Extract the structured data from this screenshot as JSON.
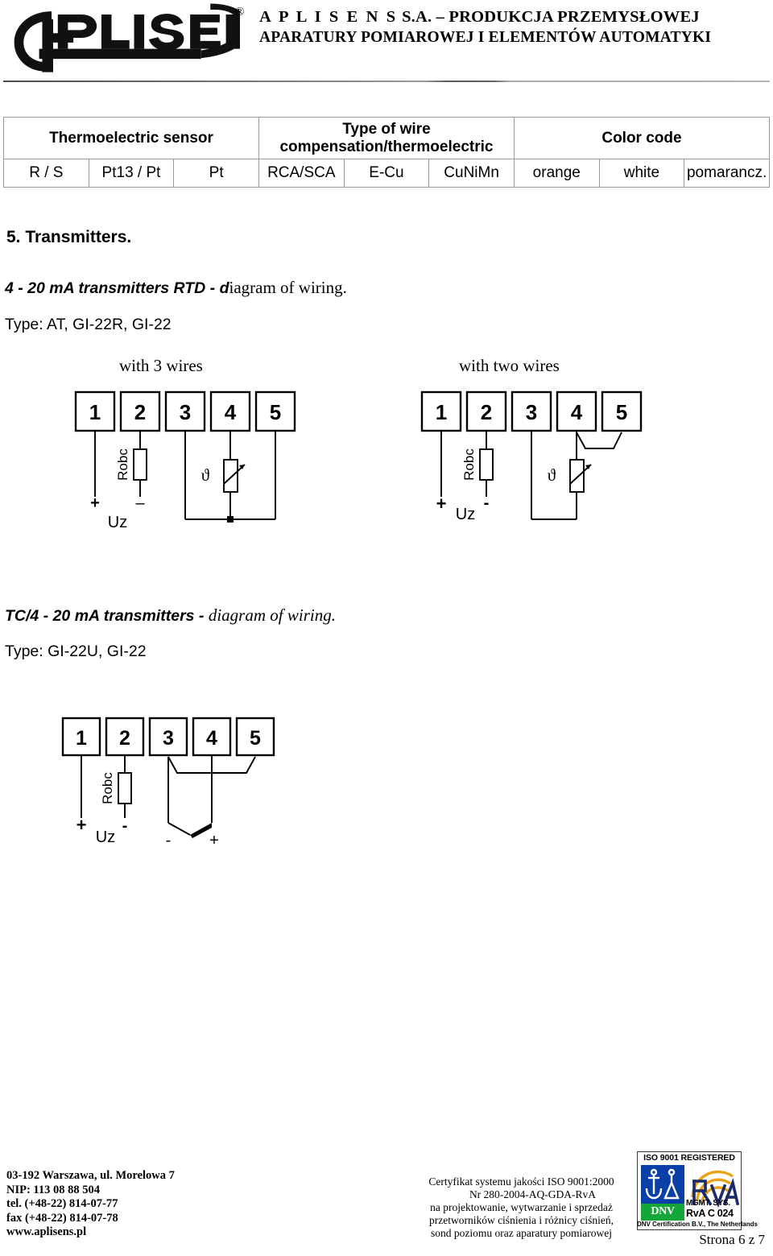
{
  "header": {
    "logo_text": "APLISENS",
    "registered_mark": "®",
    "company_line1_a": "A P L I S E N S",
    "company_line1_b": " S.A. – PRODUKCJA PRZEMYSŁOWEJ",
    "company_line2": "APARATURY POMIAROWEJ I ELEMENTÓW AUTOMATYKI"
  },
  "table": {
    "headers": [
      "Thermoelectric sensor",
      "Type of wire compensation/thermoelectric",
      "Color code"
    ],
    "header_line1_col2": "Type of wire",
    "header_line2_col2": "compensation/thermoelectric",
    "row": [
      "R / S",
      "Pt13 / Pt",
      "Pt",
      "RCA/SCA",
      "E-Cu",
      "CuNiMn",
      "orange",
      "white",
      "pomarancz."
    ]
  },
  "content": {
    "section_title": "5. Transmitters.",
    "rtd_subtitle_sans": "4 - 20 mA transmitters RTD - d",
    "rtd_subtitle_serif": "iagram of wiring.",
    "rtd_types": "Type: AT, GI-22R, GI-22",
    "caption_3wire": "with 3 wires",
    "caption_2wire": "with two wires",
    "tc_subtitle_sans": "TC/4 - 20 mA transmitters - ",
    "tc_subtitle_serif": "diagram of wiring.",
    "tc_types": "Type: GI-22U, GI-22"
  },
  "diagram": {
    "terminals": [
      "1",
      "2",
      "3",
      "4",
      "5"
    ],
    "load_label": "Robc",
    "supply_label": "Uz",
    "plus": "+",
    "minus_dash": "–",
    "minus_hyphen": "-",
    "theta": "ϑ"
  },
  "footer": {
    "address": [
      "03-192 Warszawa, ul. Morelowa 7",
      "NIP: 113 08 88 504",
      "tel. (+48-22) 814-07-77",
      "fax (+48-22) 814-07-78",
      "www.aplisens.pl"
    ],
    "cert_lines": [
      "Certyfikat systemu jakości ISO 9001:2000",
      "Nr  280-2004-AQ-GDA-RvA",
      "na projektowanie, wytwarzanie i sprzedaż",
      "przetworników ciśnienia i różnicy ciśnień,",
      "sond poziomu oraz aparatury pomiarowej"
    ],
    "page_number": "Strona 6 z 7",
    "badge": {
      "title": "ISO 9001 REGISTERED",
      "dnv": "DNV",
      "mgmt": "MGMT. SYS.",
      "rva_code": "RvA C 024",
      "bottom": "DNV Certification B.V., The Netherlands"
    }
  },
  "colors": {
    "rule": "#999999",
    "table_border": "#9a9a9a",
    "dnv_blue": "#0b3fa8",
    "dnv_green": "#15a63a",
    "rva_orange": "#e8a317",
    "text": "#000000"
  }
}
